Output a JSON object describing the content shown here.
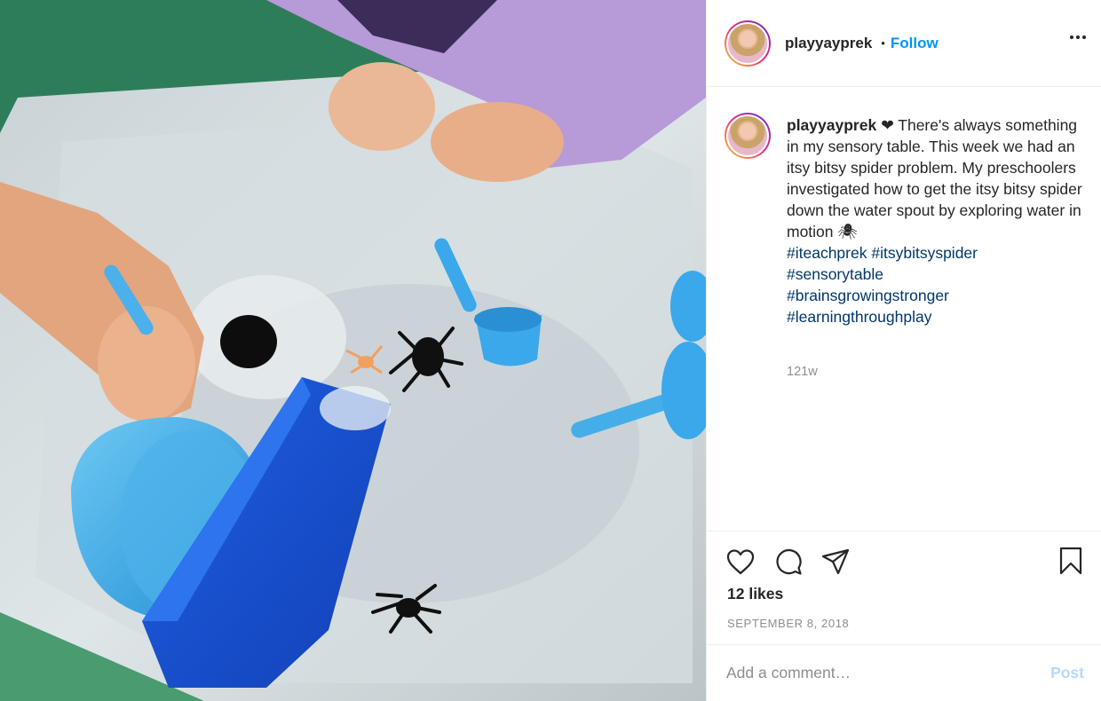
{
  "post": {
    "username": "playyayprek",
    "follow_label": "Follow",
    "separator": "•",
    "caption_text": "❤ There's always something in my sensory table. This week we had an itsy bitsy spider problem. My preschoolers investigated how to get the itsy bitsy spider down the water spout by exploring water in motion 🕷",
    "hashtags": [
      "#iteachprek",
      "#itsybitsyspider",
      "#sensorytable",
      "#brainsgrowingstronger",
      "#learningthroughplay"
    ],
    "time_ago": "121w",
    "likes": "12 likes",
    "date": "SEPTEMBER 8, 2018"
  },
  "comment": {
    "placeholder": "Add a comment…",
    "post_label": "Post"
  },
  "icons": {
    "more": "more-options-icon",
    "like": "heart-icon",
    "comment": "comment-bubble-icon",
    "share": "paper-plane-icon",
    "save": "bookmark-icon"
  },
  "colors": {
    "accent": "#0095f6",
    "hashtag": "#00376b",
    "muted": "#8e8e8e",
    "post_disabled": "#b3dbff"
  }
}
